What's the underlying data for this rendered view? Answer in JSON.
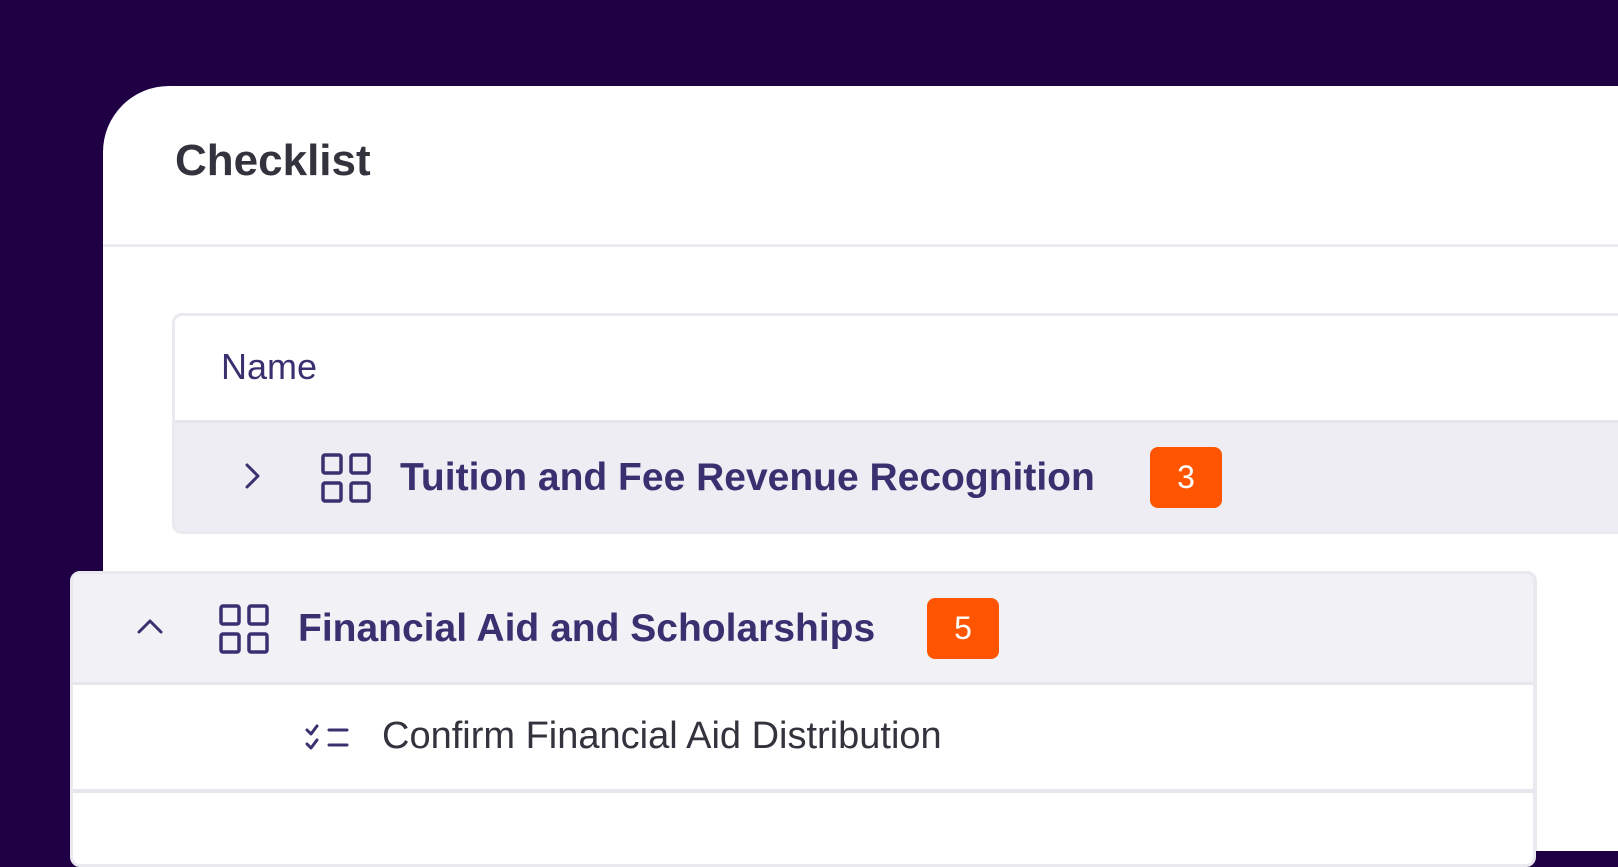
{
  "panel": {
    "title": "Checklist"
  },
  "table": {
    "column_header": "Name",
    "groups": [
      {
        "label": "Tuition and Fee Revenue Recognition",
        "count": "3",
        "expanded": false
      },
      {
        "label": "Financial Aid and Scholarships",
        "count": "5",
        "expanded": true,
        "tasks": [
          {
            "label": "Confirm Financial Aid Distribution"
          }
        ]
      }
    ]
  },
  "colors": {
    "background": "#1f0044",
    "accent_text": "#3a3070",
    "badge": "#ff5500",
    "group_row_bg": "#ededf3"
  },
  "icons": {
    "collapsed": "chevron-right-icon",
    "expanded": "chevron-up-icon",
    "group": "grid-icon",
    "task": "checklist-icon"
  }
}
